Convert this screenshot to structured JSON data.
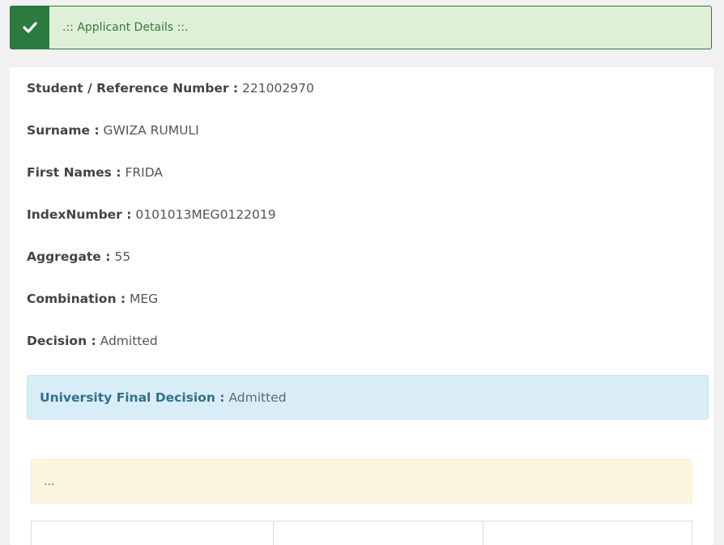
{
  "header": {
    "title": ".:: Applicant Details ::.",
    "icon": "check-icon",
    "accent_color": "#2c7a3f"
  },
  "details": {
    "reference": {
      "label": "Student / Reference Number :",
      "value": "221002970"
    },
    "surname": {
      "label": "Surname :",
      "value": "GWIZA RUMULI"
    },
    "first_names": {
      "label": "First Names :",
      "value": "FRIDA"
    },
    "index_number": {
      "label": "IndexNumber :",
      "value": "0101013MEG0122019"
    },
    "aggregate": {
      "label": "Aggregate :",
      "value": "55"
    },
    "combination": {
      "label": "Combination :",
      "value": "MEG"
    },
    "decision": {
      "label": "Decision :",
      "value": "Admitted"
    }
  },
  "final_decision": {
    "label": "University Final Decision :",
    "value": "Admitted"
  },
  "notice": {
    "text": "..."
  }
}
